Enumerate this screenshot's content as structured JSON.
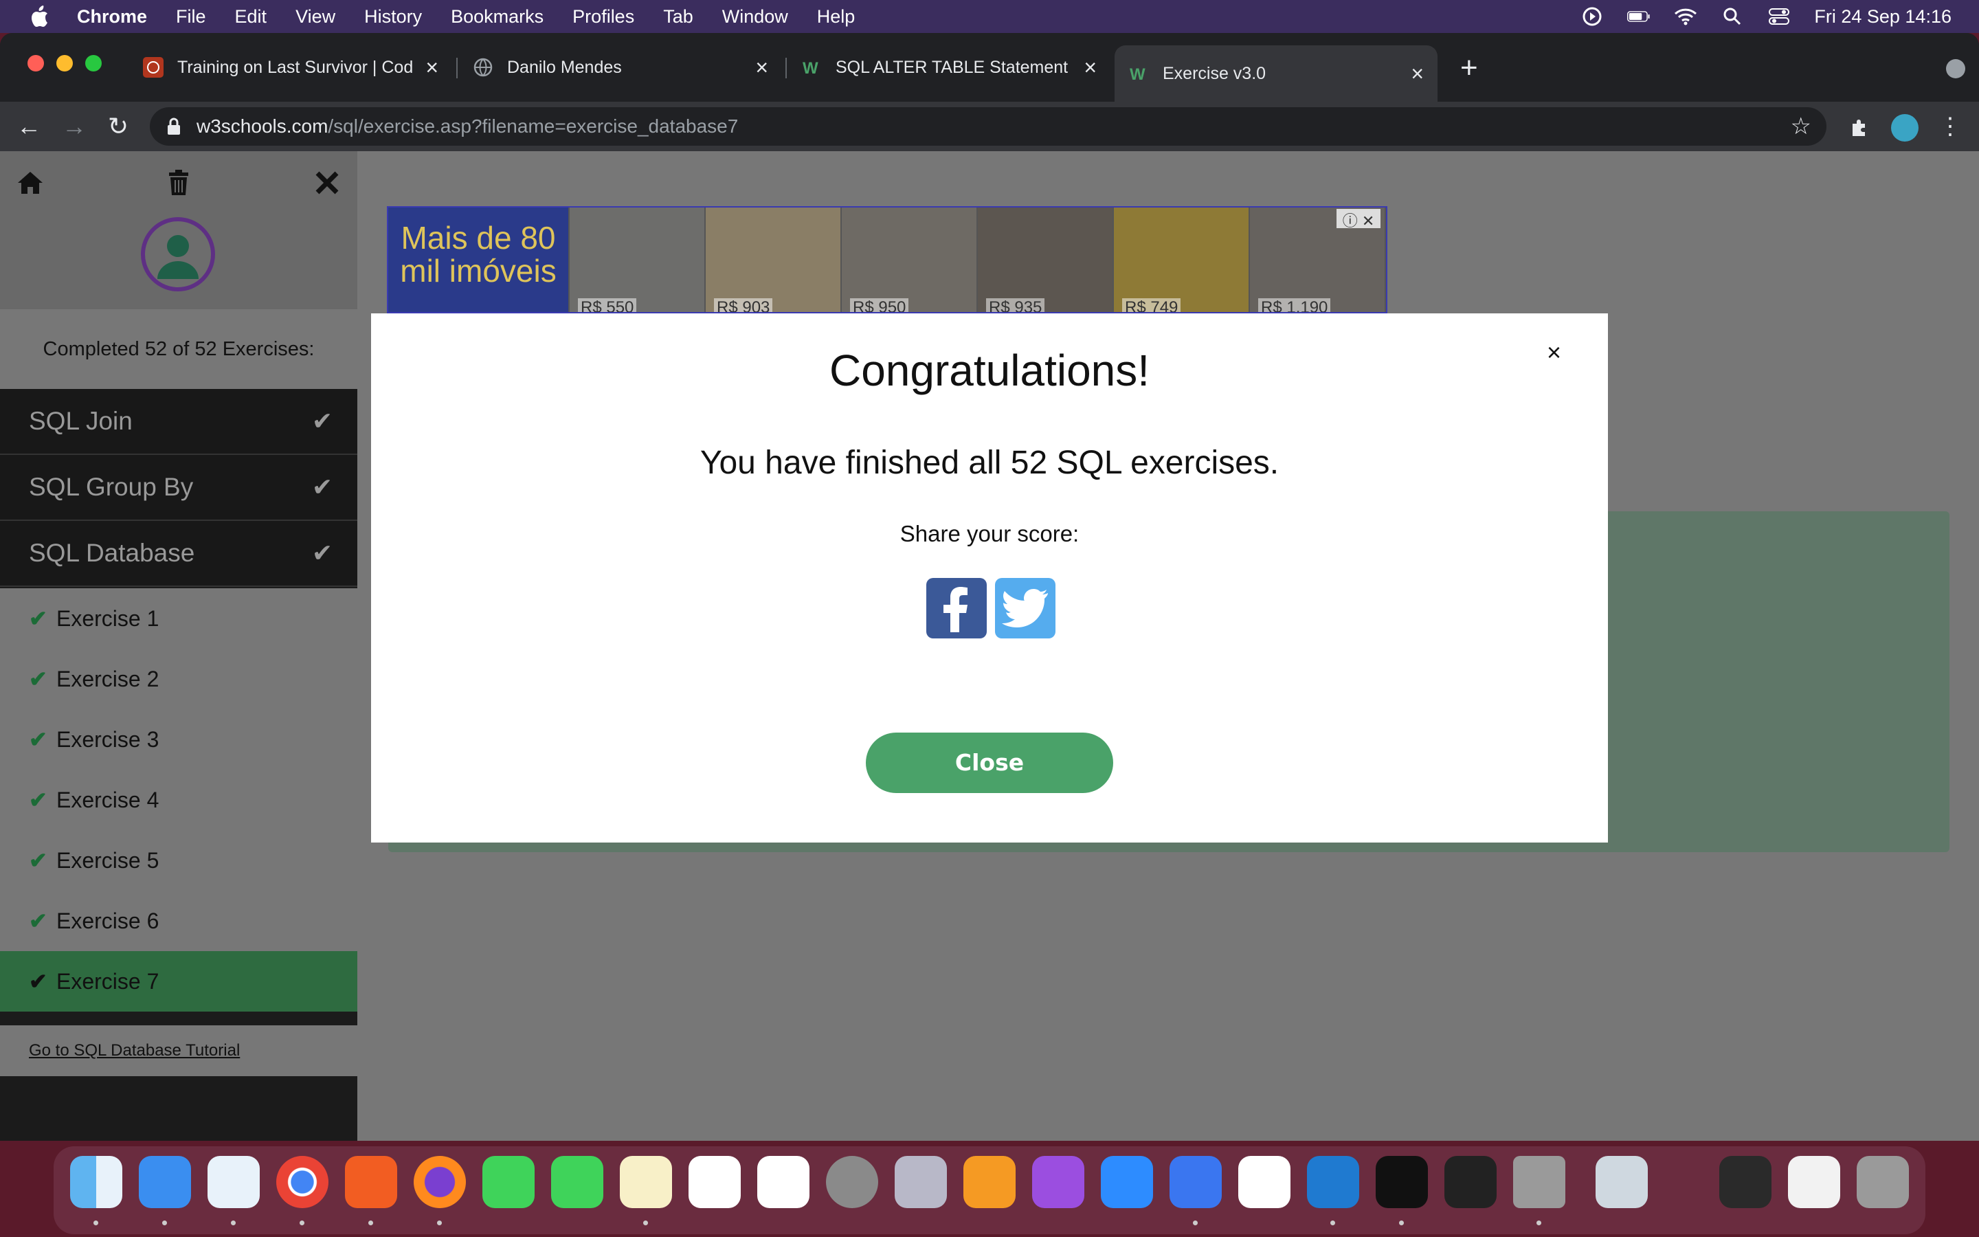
{
  "menubar": {
    "app": "Chrome",
    "items": [
      "File",
      "Edit",
      "View",
      "History",
      "Bookmarks",
      "Profiles",
      "Tab",
      "Window",
      "Help"
    ],
    "datetime": "Fri 24 Sep  14:16"
  },
  "tabs": [
    {
      "title": "Training on Last Survivor | Cod",
      "icon": "codewars-icon",
      "active": false
    },
    {
      "title": "Danilo Mendes",
      "icon": "globe-icon",
      "active": false
    },
    {
      "title": "SQL ALTER TABLE Statement",
      "icon": "w3schools-icon",
      "active": false
    },
    {
      "title": "Exercise v3.0",
      "icon": "w3schools-icon",
      "active": true
    }
  ],
  "address": {
    "host": "w3schools.com",
    "path": "/sql/exercise.asp?filename=exercise_database7"
  },
  "sidebar": {
    "completed": "Completed 52 of 52 Exercises:",
    "sections": [
      {
        "label": "SQL Join"
      },
      {
        "label": "SQL Group By"
      },
      {
        "label": "SQL Database"
      }
    ],
    "exercises": [
      {
        "label": "Exercise 1"
      },
      {
        "label": "Exercise 2"
      },
      {
        "label": "Exercise 3"
      },
      {
        "label": "Exercise 4"
      },
      {
        "label": "Exercise 5"
      },
      {
        "label": "Exercise 6"
      },
      {
        "label": "Exercise 7"
      }
    ],
    "tutorial_link": "Go to SQL Database Tutorial"
  },
  "ad": {
    "brand_text": "Mais de 80 mil imóveis",
    "prices": [
      "R$ 550",
      "R$ 903",
      "R$ 950",
      "R$ 935",
      "R$ 749",
      "R$ 1.190"
    ]
  },
  "modal": {
    "close_symbol": "×",
    "title": "Congratulations!",
    "message": "You have finished all 52 SQL exercises.",
    "share": "Share your score:",
    "close_button": "Close"
  },
  "colors": {
    "accent_green": "#4aa269",
    "facebook": "#3b5998",
    "twitter": "#55acee"
  }
}
